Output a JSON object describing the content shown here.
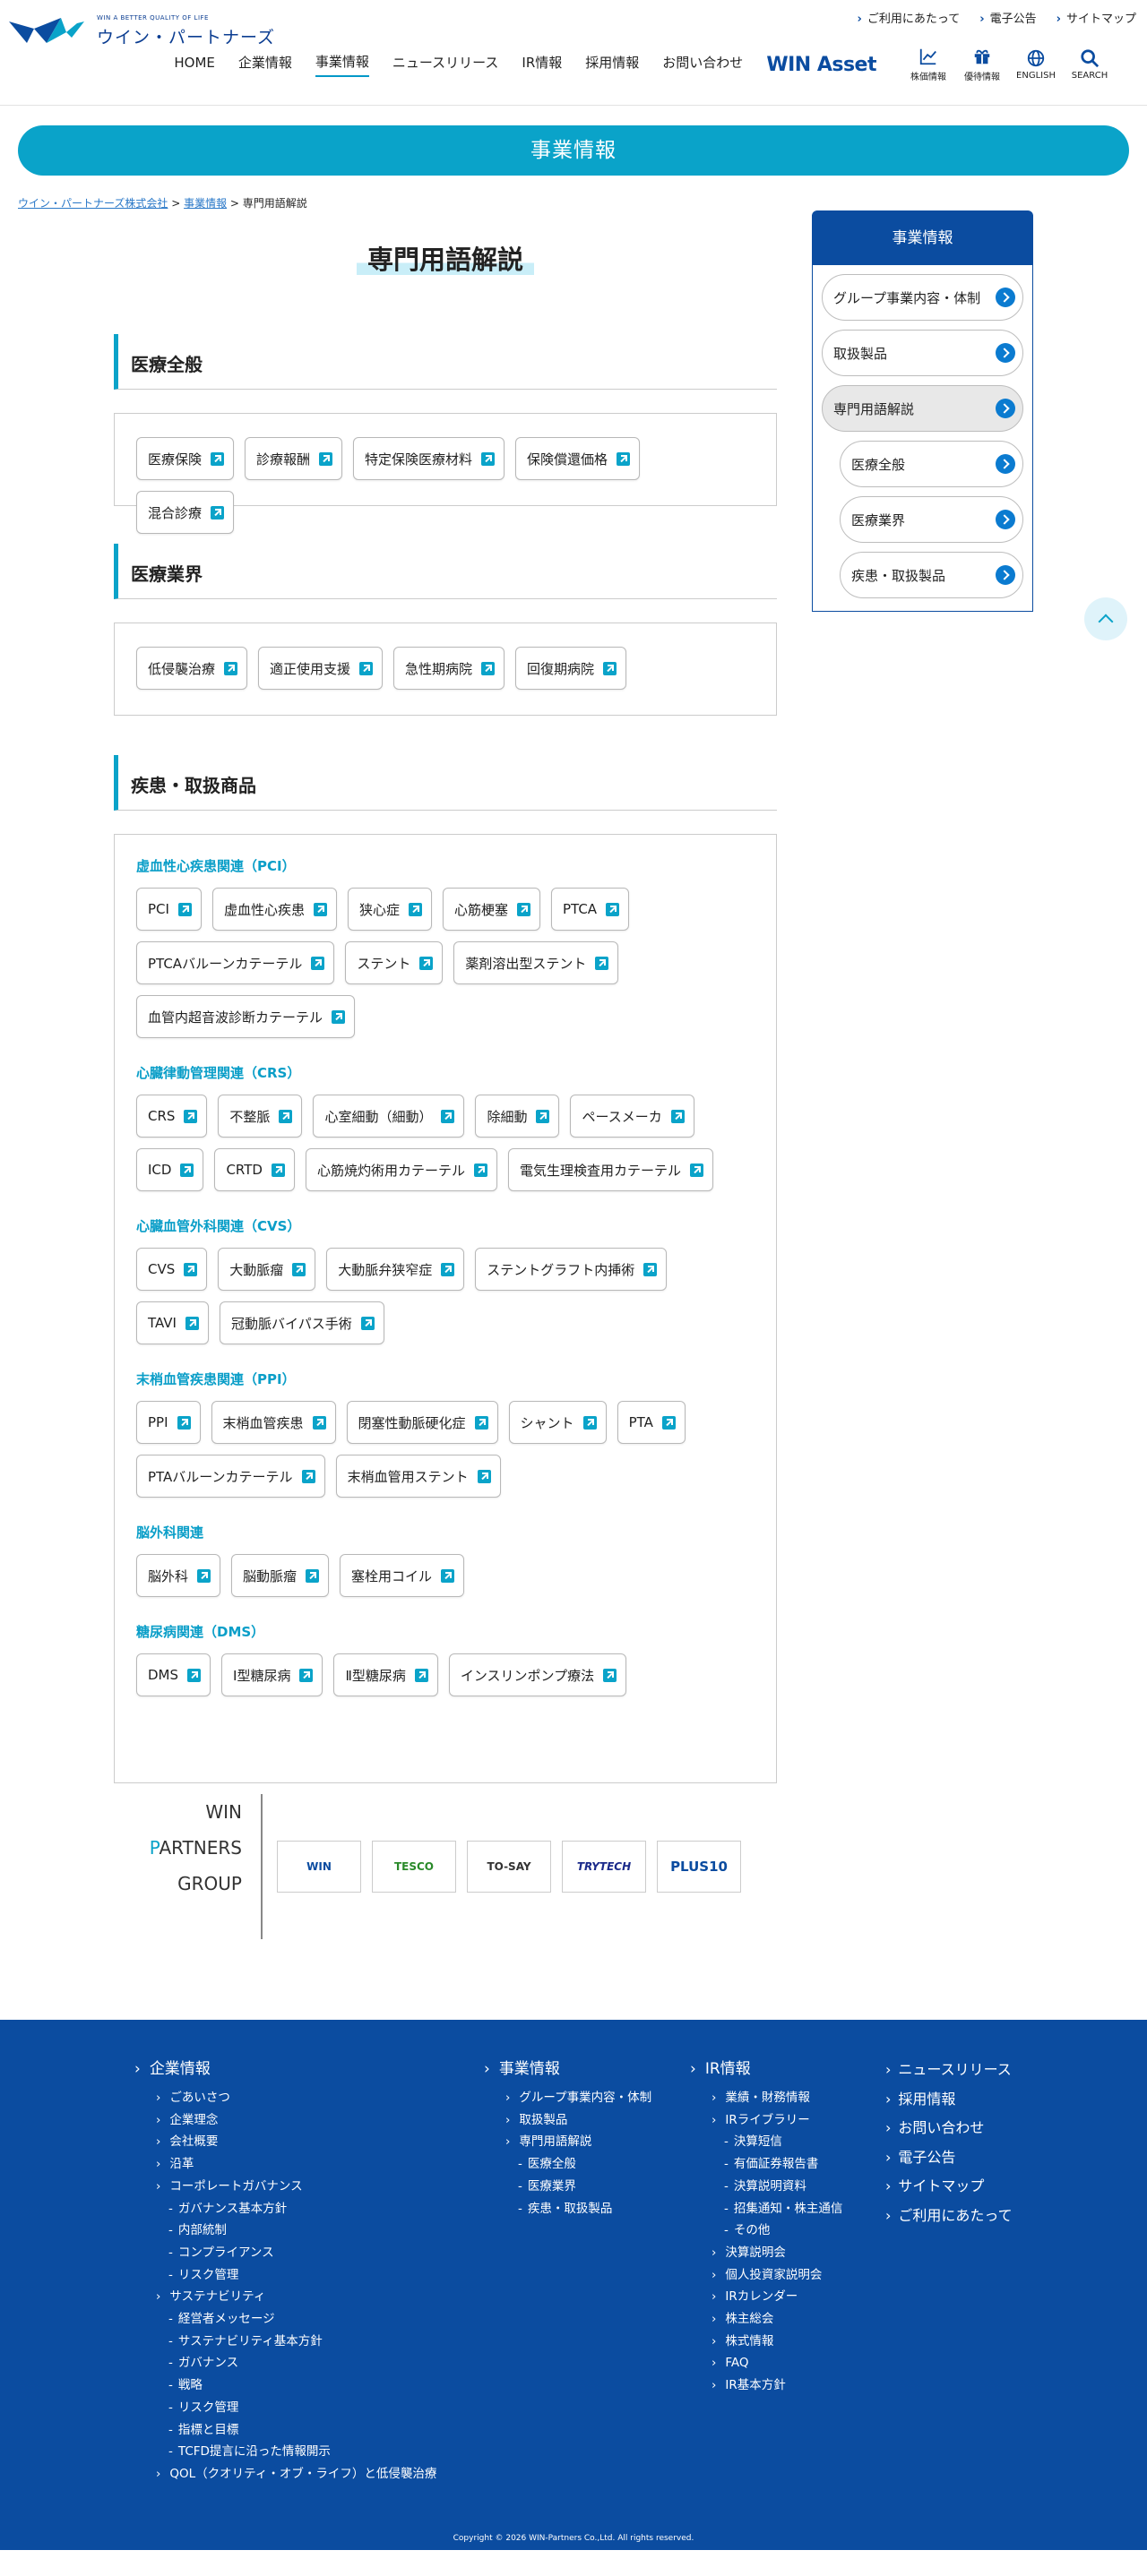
{
  "brand": {
    "tagline": "WIN A BETTER QUALITY OF LIFE",
    "name": "ウイン・パートナーズ",
    "color": "#0b4ca0",
    "accent": "#0aa3c9"
  },
  "util": [
    "ご利用にあたって",
    "電子公告",
    "サイトマップ"
  ],
  "nav": [
    "HOME",
    "企業情報",
    "事業情報",
    "ニュースリリース",
    "IR情報",
    "採用情報",
    "お問い合わせ"
  ],
  "nav_active": "事業情報",
  "win_asset": "WIN Asset",
  "icons": [
    {
      "label": "株価情報",
      "icon": "chart-icon"
    },
    {
      "label": "優待情報",
      "icon": "gift-icon"
    },
    {
      "label": "ENGLISH",
      "icon": "globe-icon"
    },
    {
      "label": "SEARCH",
      "icon": "search-icon"
    }
  ],
  "hero": "事業情報",
  "crumb": [
    "ウイン・パートナーズ株式会社",
    "事業情報",
    "専門用語解説"
  ],
  "title": "専門用語解説",
  "sections": [
    {
      "title": "医療全般",
      "cats": [
        {
          "title": "",
          "tags": [
            "医療保険",
            "診療報酬",
            "特定保険医療材料",
            "保険償還価格",
            "混合診療"
          ]
        }
      ]
    },
    {
      "title": "医療業界",
      "cats": [
        {
          "title": "",
          "tags": [
            "低侵襲治療",
            "適正使用支援",
            "急性期病院",
            "回復期病院"
          ]
        }
      ]
    },
    {
      "title": "疾患・取扱商品",
      "cats": [
        {
          "title": "虚血性心疾患関連（PCI）",
          "tags": [
            "PCI",
            "虚血性心疾患",
            "狭心症",
            "心筋梗塞",
            "PTCA",
            "PTCAバルーンカテーテル",
            "ステント",
            "薬剤溶出型ステント",
            "血管内超音波診断カテーテル"
          ]
        },
        {
          "title": "心臓律動管理関連（CRS）",
          "tags": [
            "CRS",
            "不整脈",
            "心室細動（細動）",
            "除細動",
            "ペースメーカ",
            "ICD",
            "CRTD",
            "心筋焼灼術用カテーテル",
            "電気生理検査用カテーテル"
          ]
        },
        {
          "title": "心臓血管外科関連（CVS）",
          "tags": [
            "CVS",
            "大動脈瘤",
            "大動脈弁狭窄症",
            "ステントグラフト内挿術",
            "TAVI",
            "冠動脈バイパス手術"
          ]
        },
        {
          "title": "末梢血管疾患関連（PPI）",
          "tags": [
            "PPI",
            "末梢血管疾患",
            "閉塞性動脈硬化症",
            "シャント",
            "PTA",
            "PTAバルーンカテーテル",
            "末梢血管用ステント"
          ]
        },
        {
          "title": "脳外科関連",
          "tags": [
            "脳外科",
            "脳動脈瘤",
            "塞栓用コイル"
          ]
        },
        {
          "title": "糖尿病関連（DMS）",
          "tags": [
            "DMS",
            "Ⅰ型糖尿病",
            "Ⅱ型糖尿病",
            "インスリンポンプ療法"
          ]
        }
      ]
    }
  ],
  "side": {
    "title": "事業情報",
    "items": [
      "グループ事業内容・体制",
      "取扱製品",
      "専門用語解説",
      "医療全般",
      "医療業界",
      "疾患・取扱製品"
    ],
    "active": "専門用語解説"
  },
  "group": {
    "lines": [
      "WIN",
      "ARTNERS",
      "GROUP"
    ],
    "p": "P",
    "logos": [
      "WIN",
      "TESCO",
      "TO-SAY",
      "TRYTECH",
      "PLUS10"
    ]
  },
  "footer": {
    "c1": {
      "h": "企業情報",
      "items": [
        "ごあいさつ",
        "企業理念",
        "会社概要",
        "沿革",
        "コーポレートガバナンス",
        "ガバナンス基本方針",
        "内部統制",
        "コンプライアンス",
        "リスク管理",
        "サステナビリティ",
        "経営者メッセージ",
        "サステナビリティ基本方針",
        "ガバナンス",
        "戦略",
        "リスク管理",
        "指標と目標",
        "TCFD提言に沿った情報開示",
        "QOL（クオリティ・オブ・ライフ）と低侵襲治療"
      ]
    },
    "c2": {
      "h": "事業情報",
      "items": [
        "グループ事業内容・体制",
        "取扱製品",
        "専門用語解説",
        "医療全般",
        "医療業界",
        "疾患・取扱製品"
      ]
    },
    "c3": {
      "h": "IR情報",
      "items": [
        "業績・財務情報",
        "IRライブラリー",
        "決算短信",
        "有価証券報告書",
        "決算説明資料",
        "招集通知・株主通信",
        "その他",
        "決算説明会",
        "個人投資家説明会",
        "IRカレンダー",
        "株主総会",
        "株式情報",
        "FAQ",
        "IR基本方針"
      ]
    },
    "c4": [
      "ニュースリリース",
      "採用情報",
      "お問い合わせ",
      "電子公告",
      "サイトマップ",
      "ご利用にあたって"
    ],
    "copyright": "Copyright © 2026 WIN-Partners Co.,Ltd. All rights reserved."
  }
}
